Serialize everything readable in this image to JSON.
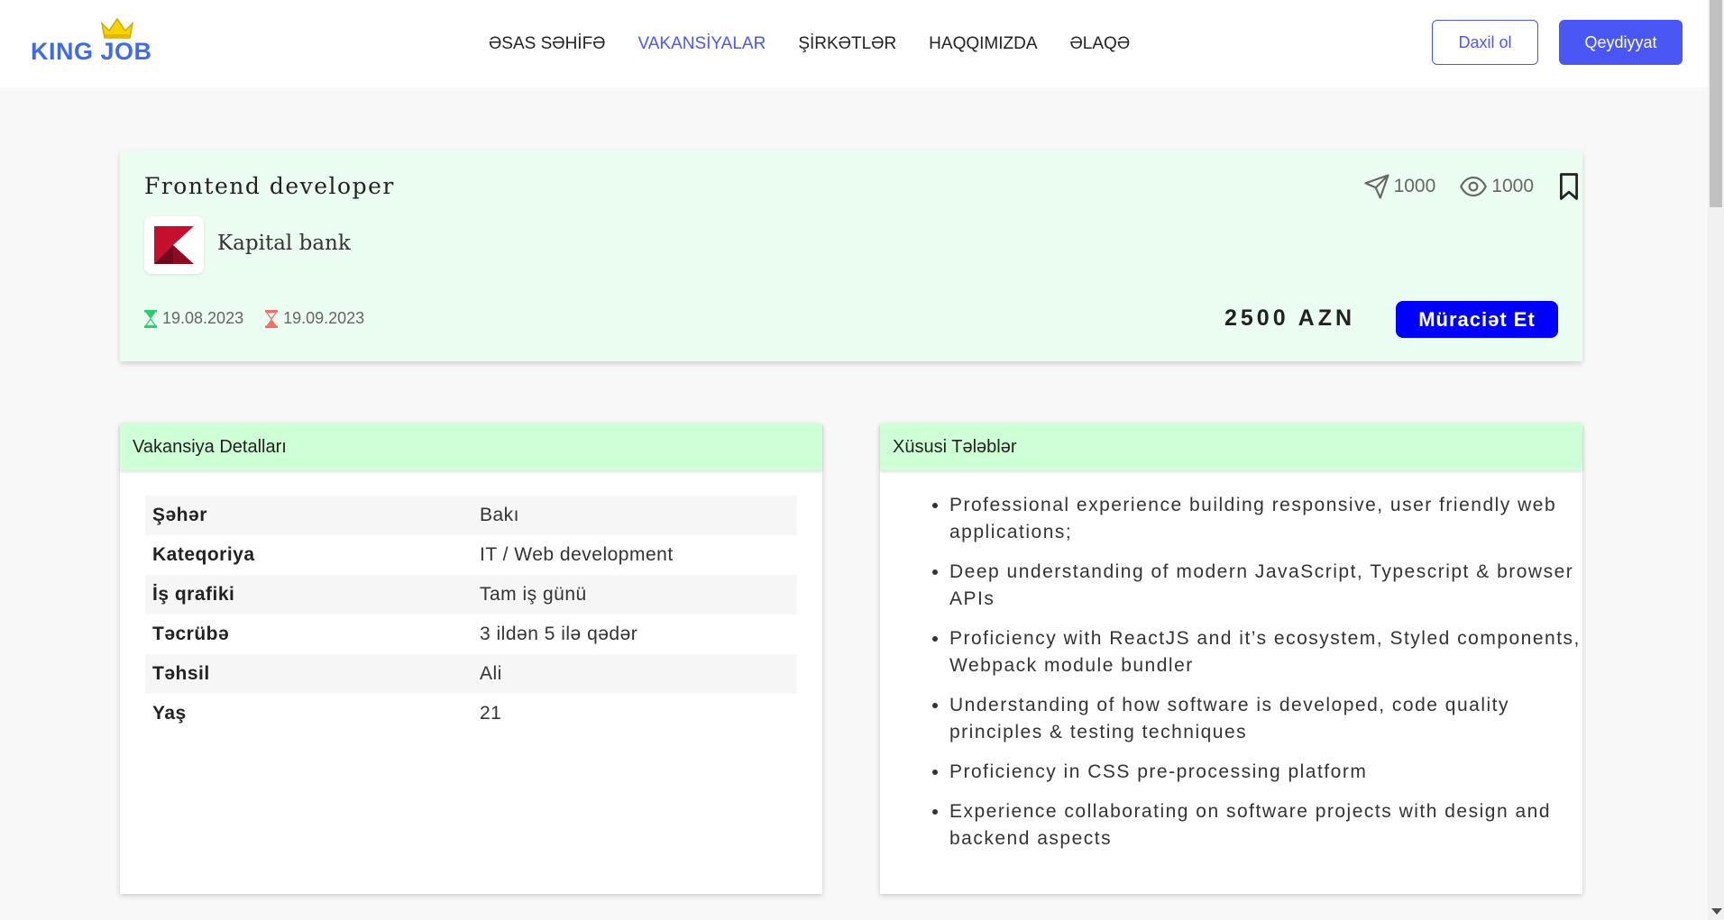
{
  "brand": {
    "name": "KING JOB",
    "crown_icon": "crown-icon",
    "color": "#3f6be9"
  },
  "nav": {
    "items": [
      {
        "label": "ƏSAS SƏHİFƏ"
      },
      {
        "label": "VAKANSİYALAR",
        "active": true
      },
      {
        "label": "ŞİRKƏTLƏR"
      },
      {
        "label": "HAQQIMIZDA"
      },
      {
        "label": "ƏLAQƏ"
      }
    ]
  },
  "auth": {
    "login_label": "Daxil ol",
    "register_label": "Qeydiyyat",
    "accent": "#4a57f5"
  },
  "job": {
    "title": "Frontend developer",
    "company": "Kapital bank",
    "applications": "1000",
    "views": "1000",
    "start_date": "19.08.2023",
    "end_date": "19.09.2023",
    "salary": "2500 AZN",
    "apply_label": "Müraciət Et",
    "icons": {
      "applications": "send-icon",
      "views": "eye-icon",
      "bookmark": "bookmark-icon",
      "start": "hourglass-green-icon",
      "end": "hourglass-red-icon"
    }
  },
  "details": {
    "heading": "Vakansiya Detalları",
    "rows": [
      {
        "key": "Şəhər",
        "value": "Bakı"
      },
      {
        "key": "Kateqoriya",
        "value": "IT / Web development"
      },
      {
        "key": "İş qrafiki",
        "value": "Tam iş günü"
      },
      {
        "key": "Təcrübə",
        "value": "3 ildən 5 ilə qədər"
      },
      {
        "key": "Təhsil",
        "value": "Ali"
      },
      {
        "key": "Yaş",
        "value": "21"
      }
    ]
  },
  "requirements": {
    "heading": "Xüsusi Tələblər",
    "items": [
      "Professional experience building responsive, user friendly web applications;",
      "Deep understanding of modern JavaScript, Typescript & browser APIs",
      "Proficiency with ReactJS and it’s ecosystem, Styled components, Webpack module bundler",
      "Understanding of how software is developed, code quality principles & testing techniques",
      "Proficiency in CSS pre-processing platform",
      "Experience collaborating on software projects with design and backend aspects"
    ]
  }
}
